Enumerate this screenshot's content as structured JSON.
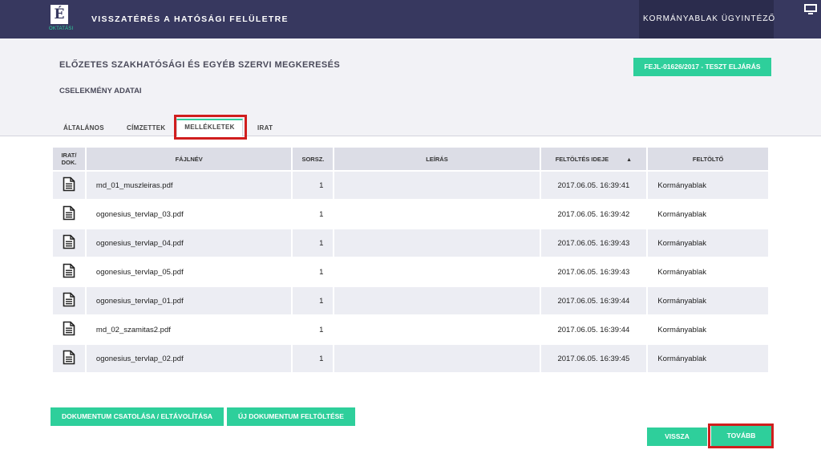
{
  "header": {
    "logo_letter": "É",
    "logo_subtitle": "OKTATÁSI",
    "app_title": "VISSZATÉRÉS A HATÓSÁGI FELÜLETRE",
    "user_menu": "KORMÁNYABLAK ÜGYINTÉZŐ",
    "user_menu_icon": "chevron-down-icon",
    "system_icon": "monitor-icon"
  },
  "page": {
    "title": "ELŐZETES SZAKHATÓSÁGI ÉS EGYÉB SZERVI MEGKERESÉS",
    "section": "CSELEKMÉNY ADATAI",
    "case_badge": "FEJL-01626/2017 - TESZT ELJÁRÁS"
  },
  "tabs": [
    {
      "label": "ÁLTALÁNOS",
      "active": false
    },
    {
      "label": "CÍMZETTEK",
      "active": false
    },
    {
      "label": "MELLÉKLETEK",
      "active": true
    },
    {
      "label": "IRAT",
      "active": false
    }
  ],
  "table": {
    "columns": {
      "type": "IRAT/\nDOK.",
      "filename": "FÁJLNÉV",
      "serial": "SORSZ.",
      "description": "LEÍRÁS",
      "upload_time": "FELTÖLTÉS IDEJE",
      "uploader": "FELTÖLTŐ"
    },
    "sort_indicator": "▲",
    "rows": [
      {
        "icon": "document-icon",
        "filename": "md_01_muszleiras.pdf",
        "serial": "1",
        "description": "",
        "upload_time": "2017.06.05. 16:39:41",
        "uploader": "Kormányablak"
      },
      {
        "icon": "document-icon",
        "filename": "ogonesius_tervlap_03.pdf",
        "serial": "1",
        "description": "",
        "upload_time": "2017.06.05. 16:39:42",
        "uploader": "Kormányablak"
      },
      {
        "icon": "document-icon",
        "filename": "ogonesius_tervlap_04.pdf",
        "serial": "1",
        "description": "",
        "upload_time": "2017.06.05. 16:39:43",
        "uploader": "Kormányablak"
      },
      {
        "icon": "document-icon",
        "filename": "ogonesius_tervlap_05.pdf",
        "serial": "1",
        "description": "",
        "upload_time": "2017.06.05. 16:39:43",
        "uploader": "Kormányablak"
      },
      {
        "icon": "document-icon",
        "filename": "ogonesius_tervlap_01.pdf",
        "serial": "1",
        "description": "",
        "upload_time": "2017.06.05. 16:39:44",
        "uploader": "Kormányablak"
      },
      {
        "icon": "document-icon",
        "filename": "md_02_szamitas2.pdf",
        "serial": "1",
        "description": "",
        "upload_time": "2017.06.05. 16:39:44",
        "uploader": "Kormányablak"
      },
      {
        "icon": "document-icon",
        "filename": "ogonesius_tervlap_02.pdf",
        "serial": "1",
        "description": "",
        "upload_time": "2017.06.05. 16:39:45",
        "uploader": "Kormányablak"
      }
    ]
  },
  "actions": {
    "attach_label": "DOKUMENTUM CSATOLÁSA / ELTÁVOLÍTÁSA",
    "upload_label": "ÚJ DOKUMENTUM FELTÖLTÉSE",
    "back_label": "VISSZA",
    "next_label": "TOVÁBB"
  },
  "colors": {
    "header_bg": "#37385f",
    "accent": "#2ecf9b",
    "highlight": "#d01e1e"
  }
}
